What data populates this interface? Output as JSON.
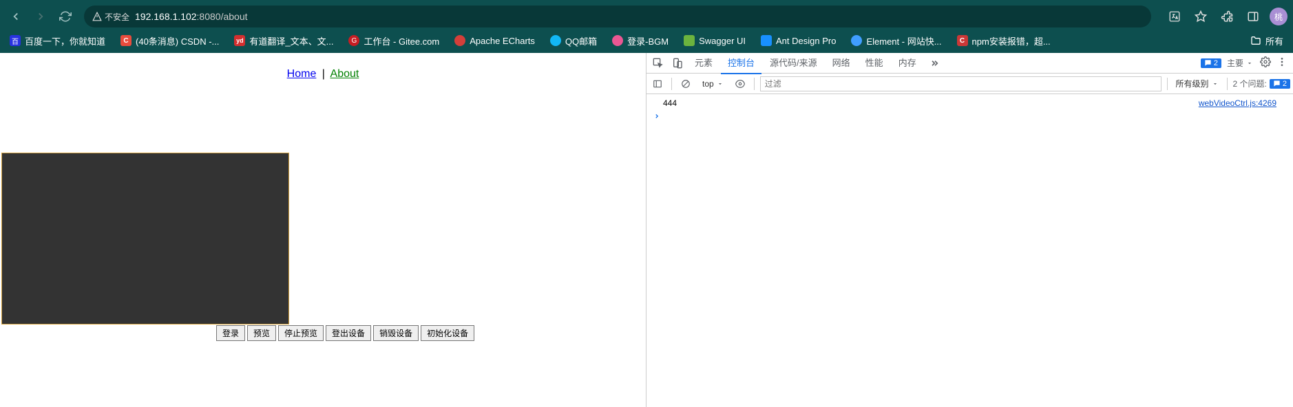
{
  "browser": {
    "insecure_label": "不安全",
    "url_host": "192.168.1.102",
    "url_port": ":8080",
    "url_path": "/about",
    "avatar_letter": "桃"
  },
  "bookmarks": {
    "items": [
      {
        "label": "百度一下，你就知道"
      },
      {
        "label": "(40条消息) CSDN -..."
      },
      {
        "label": "有道翻译_文本、文..."
      },
      {
        "label": "工作台 - Gitee.com"
      },
      {
        "label": "Apache ECharts"
      },
      {
        "label": "QQ邮箱"
      },
      {
        "label": "登录-BGM"
      },
      {
        "label": "Swagger UI"
      },
      {
        "label": "Ant Design Pro"
      },
      {
        "label": "Element - 网站快..."
      },
      {
        "label": "npm安装报错，超..."
      }
    ],
    "all_label": "所有"
  },
  "page": {
    "nav_home": "Home",
    "nav_sep": "|",
    "nav_about": "About",
    "buttons": {
      "login": "登录",
      "preview": "预览",
      "stop_preview": "停止预览",
      "logout_device": "登出设备",
      "destroy_device": "销毁设备",
      "init_device": "初始化设备"
    }
  },
  "devtools": {
    "tabs": {
      "elements": "元素",
      "console": "控制台",
      "sources": "源代码/来源",
      "network": "网络",
      "performance": "性能",
      "memory": "内存"
    },
    "badge_count": "2",
    "main_label": "主要",
    "filterbar": {
      "context": "top",
      "filter_placeholder": "过滤",
      "levels_label": "所有级别",
      "issues_label": "2 个问题:",
      "issues_count": "2"
    },
    "console": {
      "log_msg": "444",
      "log_src": "webVideoCtrl.js:4269"
    }
  }
}
